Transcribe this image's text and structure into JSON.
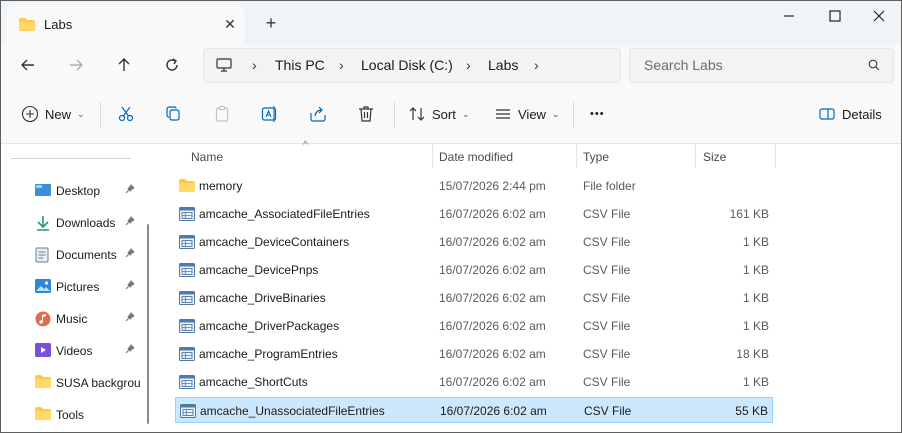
{
  "window": {
    "tab_title": "Labs",
    "tab_close_glyph": "✕",
    "new_tab_glyph": "+",
    "controls": {
      "minimize": "—",
      "maximize": "☐",
      "close": "✕"
    }
  },
  "nav": {
    "breadcrumbs": [
      "This PC",
      "Local Disk (C:)",
      "Labs"
    ],
    "chevron": "›",
    "search_placeholder": "Search Labs"
  },
  "toolbar": {
    "new_label": "New",
    "sort_label": "Sort",
    "view_label": "View",
    "more_glyph": "•••",
    "details_label": "Details",
    "caret": "⌄"
  },
  "sidebar": {
    "items": [
      {
        "label": "Desktop",
        "icon": "desktop-icon",
        "pinned": true
      },
      {
        "label": "Downloads",
        "icon": "download-icon",
        "pinned": true
      },
      {
        "label": "Documents",
        "icon": "documents-icon",
        "pinned": true
      },
      {
        "label": "Pictures",
        "icon": "pictures-icon",
        "pinned": true
      },
      {
        "label": "Music",
        "icon": "music-icon",
        "pinned": true
      },
      {
        "label": "Videos",
        "icon": "videos-icon",
        "pinned": true
      },
      {
        "label": "SUSA backgrou",
        "icon": "folder-icon",
        "pinned": false
      },
      {
        "label": "Tools",
        "icon": "folder-icon",
        "pinned": false
      }
    ],
    "pin_glyph": "📌"
  },
  "columns": {
    "name": "Name",
    "date": "Date modified",
    "type": "Type",
    "size": "Size",
    "sort_glyph": "^"
  },
  "files": [
    {
      "name": "memory",
      "date": "15/07/2026 2:44 pm",
      "type": "File folder",
      "size": "",
      "kind": "folder"
    },
    {
      "name": "amcache_AssociatedFileEntries",
      "date": "16/07/2026 6:02 am",
      "type": "CSV File",
      "size": "161 KB",
      "kind": "csv"
    },
    {
      "name": "amcache_DeviceContainers",
      "date": "16/07/2026 6:02 am",
      "type": "CSV File",
      "size": "1 KB",
      "kind": "csv"
    },
    {
      "name": "amcache_DevicePnps",
      "date": "16/07/2026 6:02 am",
      "type": "CSV File",
      "size": "1 KB",
      "kind": "csv"
    },
    {
      "name": "amcache_DriveBinaries",
      "date": "16/07/2026 6:02 am",
      "type": "CSV File",
      "size": "1 KB",
      "kind": "csv"
    },
    {
      "name": "amcache_DriverPackages",
      "date": "16/07/2026 6:02 am",
      "type": "CSV File",
      "size": "1 KB",
      "kind": "csv"
    },
    {
      "name": "amcache_ProgramEntries",
      "date": "16/07/2026 6:02 am",
      "type": "CSV File",
      "size": "18 KB",
      "kind": "csv"
    },
    {
      "name": "amcache_ShortCuts",
      "date": "16/07/2026 6:02 am",
      "type": "CSV File",
      "size": "1 KB",
      "kind": "csv"
    },
    {
      "name": "amcache_UnassociatedFileEntries",
      "date": "16/07/2026 6:02 am",
      "type": "CSV File",
      "size": "55 KB",
      "kind": "csv",
      "selected": true
    }
  ],
  "colors": {
    "accent": "#0067c0",
    "selection": "#cce8ff",
    "folder": "#ffc83d"
  }
}
